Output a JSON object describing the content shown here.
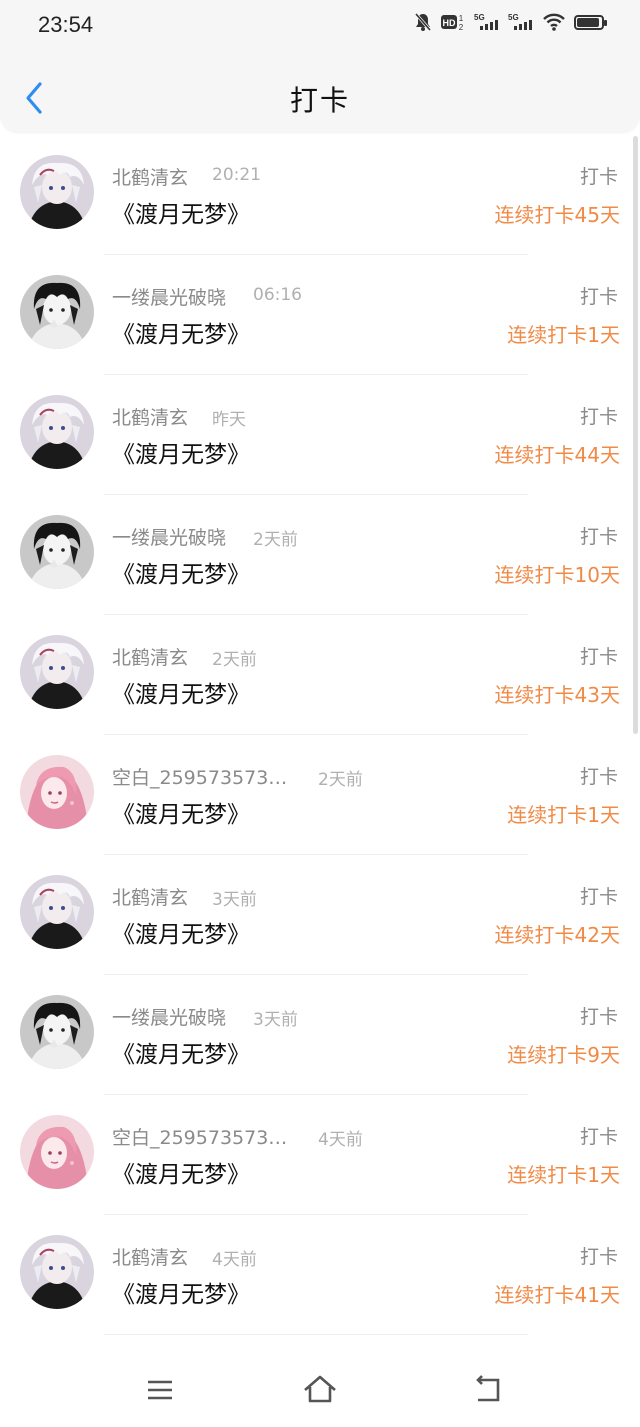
{
  "status": {
    "time": "23:54",
    "icons": [
      "bell-off-icon",
      "hd-icon",
      "signal-5g-icon",
      "signal-5g-icon",
      "wifi-icon",
      "battery-icon"
    ],
    "battery_level": 0.9
  },
  "header": {
    "title": "打卡",
    "back_icon": "chevron-left-icon",
    "accent": "#2f8cf0"
  },
  "colors": {
    "streak": "#f08a45",
    "name": "#8a8a8a",
    "time": "#b0b0b0"
  },
  "items": [
    {
      "name": "北鹤清玄",
      "time": "20:21",
      "book": "《渡月无梦》",
      "type": "打卡",
      "streak": "连续打卡45天",
      "avatar": "white-hair-boy"
    },
    {
      "name": "一缕晨光破晓",
      "time": "06:16",
      "book": "《渡月无梦》",
      "type": "打卡",
      "streak": "连续打卡1天",
      "avatar": "dark-hair-boy"
    },
    {
      "name": "北鹤清玄",
      "time": "昨天",
      "book": "《渡月无梦》",
      "type": "打卡",
      "streak": "连续打卡44天",
      "avatar": "white-hair-boy"
    },
    {
      "name": "一缕晨光破晓",
      "time": "2天前",
      "book": "《渡月无梦》",
      "type": "打卡",
      "streak": "连续打卡10天",
      "avatar": "dark-hair-boy"
    },
    {
      "name": "北鹤清玄",
      "time": "2天前",
      "book": "《渡月无梦》",
      "type": "打卡",
      "streak": "连续打卡43天",
      "avatar": "white-hair-boy"
    },
    {
      "name": "空白_259573573…",
      "time": "2天前",
      "book": "《渡月无梦》",
      "type": "打卡",
      "streak": "连续打卡1天",
      "avatar": "pink-hair-girl"
    },
    {
      "name": "北鹤清玄",
      "time": "3天前",
      "book": "《渡月无梦》",
      "type": "打卡",
      "streak": "连续打卡42天",
      "avatar": "white-hair-boy"
    },
    {
      "name": "一缕晨光破晓",
      "time": "3天前",
      "book": "《渡月无梦》",
      "type": "打卡",
      "streak": "连续打卡9天",
      "avatar": "dark-hair-boy"
    },
    {
      "name": "空白_259573573…",
      "time": "4天前",
      "book": "《渡月无梦》",
      "type": "打卡",
      "streak": "连续打卡1天",
      "avatar": "pink-hair-girl"
    },
    {
      "name": "北鹤清玄",
      "time": "4天前",
      "book": "《渡月无梦》",
      "type": "打卡",
      "streak": "连续打卡41天",
      "avatar": "white-hair-boy"
    }
  ],
  "nav": {
    "buttons": [
      "menu-icon",
      "home-icon",
      "back-icon"
    ]
  }
}
